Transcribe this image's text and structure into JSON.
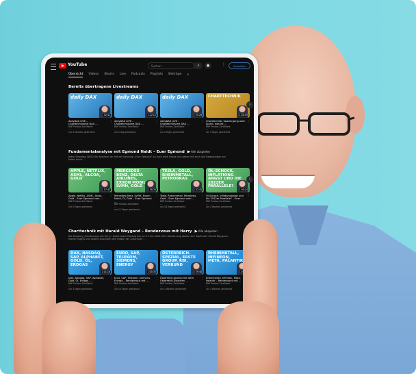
{
  "app": {
    "brand": "YouTube",
    "search_placeholder": "Suchen",
    "signin_label": "Anmelden",
    "menu_glyph": "⋮"
  },
  "tabs": [
    {
      "label": "Übersicht",
      "active": true
    },
    {
      "label": "Videos"
    },
    {
      "label": "Shorts"
    },
    {
      "label": "Live"
    },
    {
      "label": "Podcasts"
    },
    {
      "label": "Playlists"
    },
    {
      "label": "Beiträge"
    }
  ],
  "sections": [
    {
      "title": "Bereits übertragene Livestreams",
      "videos": [
        {
          "thumb": "daily DAX",
          "title": "dailyDAX LIVE – Charttechnische DAX ...",
          "channel": "BNP Paribas Zertifikate",
          "views": "...",
          "age": "vor 4 Stunden gestreamt",
          "duration": "52:41"
        },
        {
          "thumb": "daily DAX",
          "title": "dailyDAX LIVE – Charttechnische DAX ...",
          "channel": "BNP Paribas Zertifikate",
          "views": "...",
          "age": "vor 1 Tag gestreamt",
          "duration": "1:12:12"
        },
        {
          "thumb": "daily DAX",
          "title": "dailyDAX LIVE – Charttechnische DAX ...",
          "channel": "BNP Paribas Zertifikate",
          "views": "...",
          "age": "vor 2 Tagen gestreamt",
          "duration": "55:26"
        },
        {
          "thumb": "CHARTTECHNIK",
          "title": "Charttechnik: Spaziergang oder Sprint, was ist ...",
          "channel": "BNP Paribas Zertifikate",
          "views": "...",
          "age": "vor 3 Tagen gestreamt",
          "duration": "1:00:09"
        }
      ]
    },
    {
      "title": "Fundamentalanalyse mit Egmond Haidt – Euer Egmond",
      "desc": "Jeden Dienstag 18:00 Uhr kommen wir mit der Sendung „Euer Egmond“ zu euch nach Hause und gehen mit euch alle Bewegungen am Markt durch ...",
      "videos": [
        {
          "thumb": "APPLE, NETFLIX, ASML, ALCOA, GOLD",
          "title": "Apple, Netflix, ASML, Alcoa, Gold – Euer Egmond vom ...",
          "channel": "BNP Paribas Zertifikate",
          "views": "...",
          "age": "vor 4 Tagen gestreamt",
          "duration": "57:43"
        },
        {
          "thumb": "MERCEDES-BENZ, DELTA AIRLINES, EXXON MOBIL, LVMH, GOLD",
          "title": "Mercedes-Benz, LVMH, Exxon Mobil, Öl, Gold – Euer Egmond ...",
          "channel": "BNP Paribas Zertifikate",
          "views": "...",
          "age": "vor 11 Tagen gestreamt",
          "duration": "58:20"
        },
        {
          "thumb": "TESLA, GOLD, RHEINMETALL, PETROBRAS",
          "title": "Tesla, Rheinmetall, Petrobras, Gold – Euer Egmond vom ...",
          "channel": "BNP Paribas Zertifikate",
          "views": "...",
          "age": "vor 18 Tagen gestreamt",
          "duration": "57:45"
        },
        {
          "thumb": "ÖL-SCHOCK, INFLATIONS-ANGST und die 2022er Parallele?",
          "title": "Öl-Schock, Inflationsangst und die 2022er Parallele? – Euer ...",
          "channel": "BNP Paribas Zertifikate",
          "views": "...",
          "age": "vor 4 Wochen gestreamt",
          "duration": "1:00:24"
        }
      ]
    },
    {
      "title": "Charttechnik mit Harald Weygand – Rendezvous mit Harry",
      "desc": "Die Sendung „Rendezvous mit Harry“ findet jeden Montag live um 19 Uhr statt. Eine Stunde lang stellen sich Top-Trader Harald Weygand, Marcel Rugers und andere Analysten den Fragen der Zuschauer ...",
      "videos": [
        {
          "thumb": "DAX, NASDAQ, SAP, ALPHABET, GOLD, ÖL, ERDGAS",
          "title": "DAX, Nasdaq, SAP, Alphabet, Gold, Öl, Erdgas – ...",
          "channel": "BNP Paribas Zertifikate",
          "views": "...",
          "age": "vor 3 Tagen gestreamt",
          "duration": "1:01:16"
        },
        {
          "thumb": "EURO, SAP, TELEKOM, SIEMENS, ENERGY",
          "title": "Euro, SAP, Telekom, Siemens, Energy – Rendezvous mit ...",
          "channel": "BNP Paribas Zertifikate",
          "views": "...",
          "age": "vor 10 Tagen gestreamt",
          "duration": "1:00:35"
        },
        {
          "thumb": "ÖSTERREICH-SPEZIAL, ERSTE GROUP, RBI, VERBUND",
          "title": "Österreich-Spezial mit dem Osterreich-Experten ...",
          "channel": "BNP Paribas Zertifikate",
          "views": "...",
          "age": "vor 2 Wochen gestreamt",
          "duration": "59:48"
        },
        {
          "thumb": "RHEINMETALL, INFINEON, META, PALANTIR",
          "title": "Rheinmetall, Infineon, Meta, Palantir – Rendezvous mit ...",
          "channel": "BNP Paribas Zertifikate",
          "views": "...",
          "age": "vor 3 Wochen gestreamt",
          "duration": "1:04:29"
        }
      ]
    }
  ],
  "play_all_label": "Alle abspielen",
  "colors": {
    "background": "#7dd8e3",
    "screen": "#0f0f0f",
    "accent": "#ff0000"
  }
}
